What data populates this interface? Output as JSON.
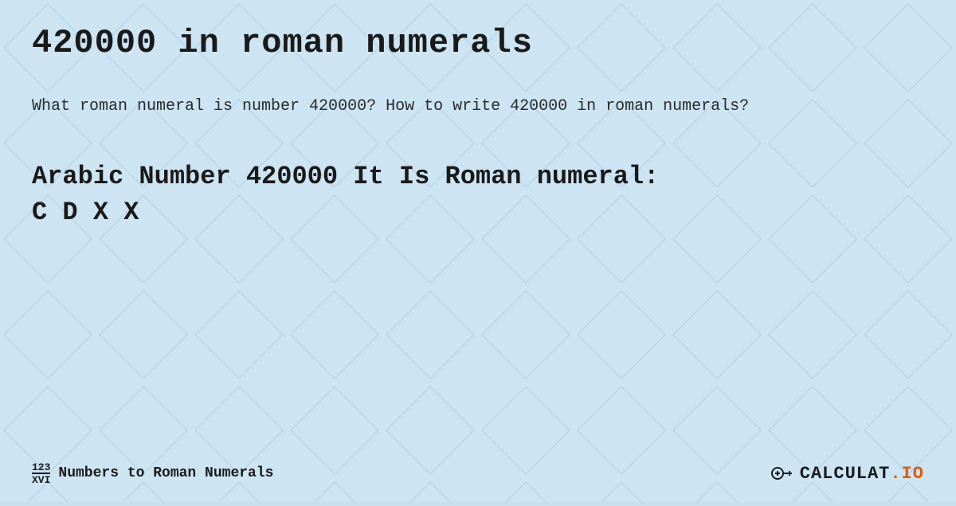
{
  "page": {
    "title": "420000 in roman numerals",
    "description": "What roman numeral is number 420000? How to write 420000 in roman numerals?",
    "result_line1": "Arabic Number 420000 It Is  Roman numeral:",
    "result_line2": "C D X X",
    "footer": {
      "logo_top": "123",
      "logo_bottom": "XVI",
      "site_title": "Numbers to Roman Numerals",
      "brand_name": "CALCULAT",
      "brand_tld": ".IO"
    },
    "colors": {
      "background": "#cde4f3",
      "text_dark": "#1a1a1a",
      "accent_orange": "#e05a00"
    }
  }
}
